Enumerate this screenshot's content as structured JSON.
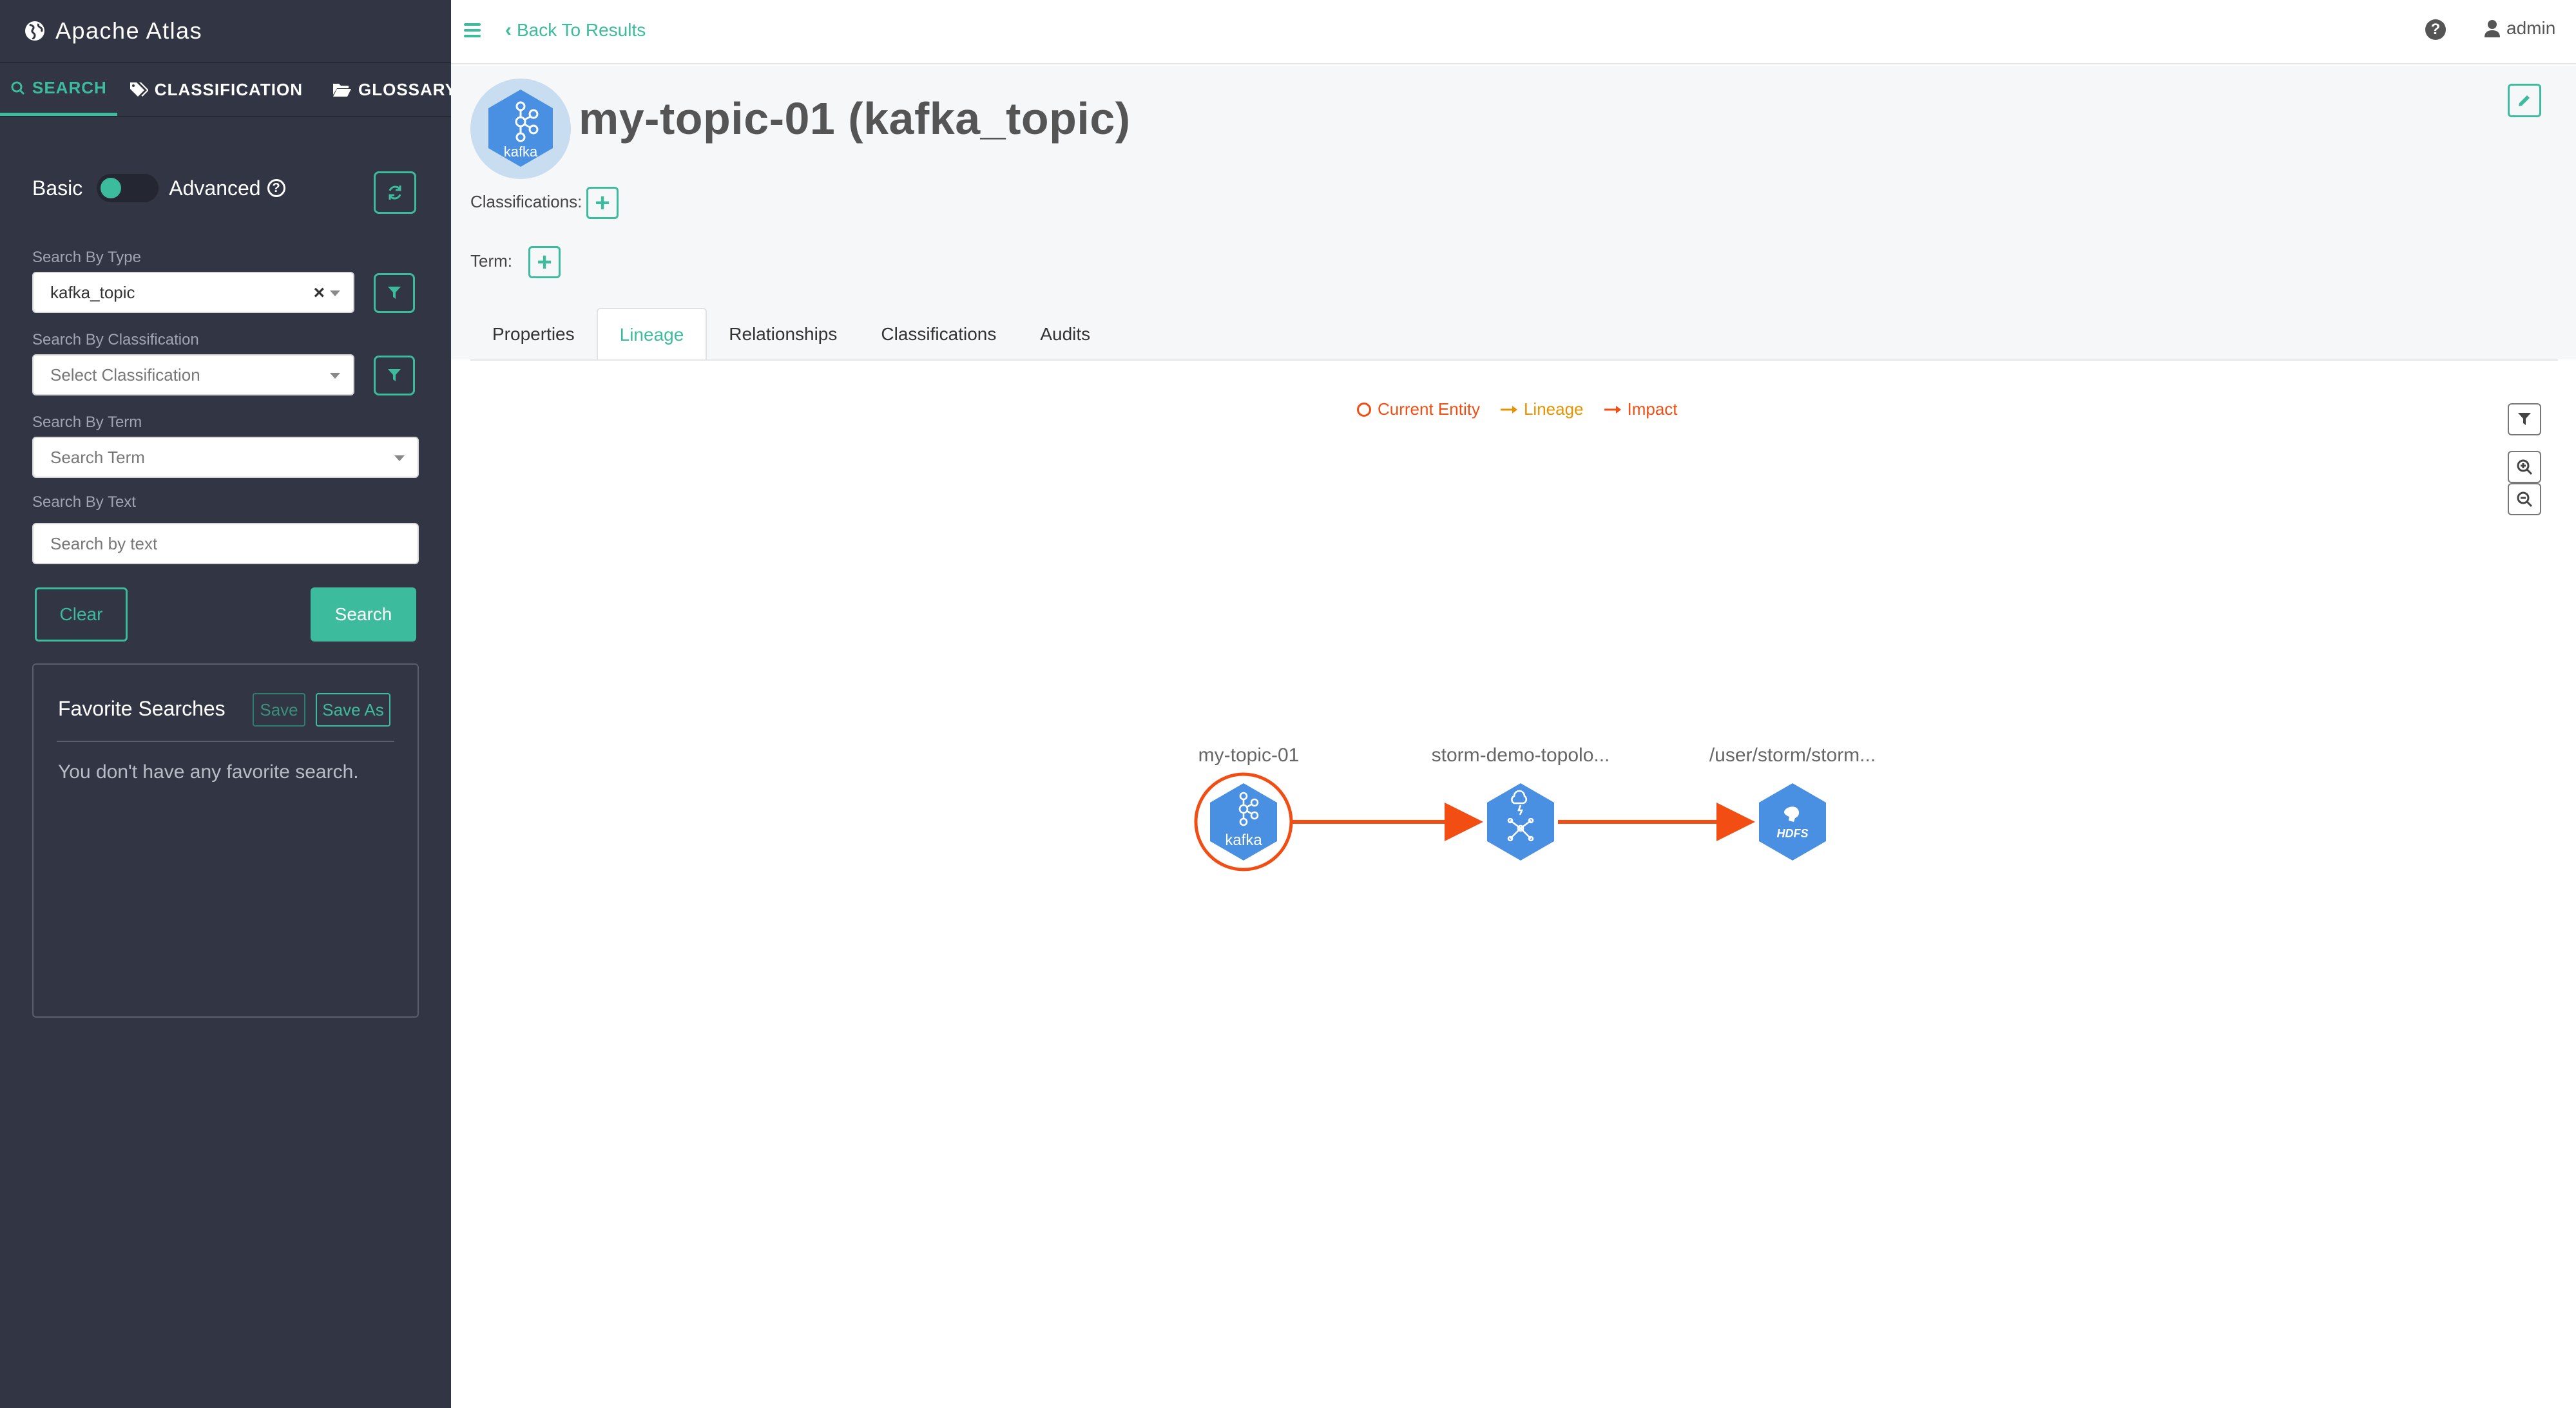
{
  "app": {
    "title": "Apache Atlas"
  },
  "sidebar": {
    "tabs": [
      {
        "label": "SEARCH",
        "icon": "search-icon",
        "active": true
      },
      {
        "label": "CLASSIFICATION",
        "icon": "tags-icon"
      },
      {
        "label": "GLOSSARY",
        "icon": "folder-open-icon"
      }
    ],
    "toggle": {
      "basic_label": "Basic",
      "advanced_label": "Advanced",
      "mode": "Basic"
    },
    "search_by_type": {
      "label": "Search By Type",
      "value": "kafka_topic"
    },
    "search_by_classification": {
      "label": "Search By Classification",
      "placeholder": "Select Classification"
    },
    "search_by_term": {
      "label": "Search By Term",
      "placeholder": "Search Term"
    },
    "search_by_text": {
      "label": "Search By Text",
      "placeholder": "Search by text"
    },
    "clear_label": "Clear",
    "search_label": "Search",
    "favorites": {
      "title": "Favorite Searches",
      "save_label": "Save",
      "save_as_label": "Save As",
      "empty_text": "You don't have any favorite search."
    }
  },
  "topbar": {
    "back_label": "Back To Results",
    "user": "admin"
  },
  "entity": {
    "title": "my-topic-01 (kafka_topic)",
    "icon_text": "kafka",
    "classifications_label": "Classifications:",
    "term_label": "Term:"
  },
  "tabs": [
    {
      "label": "Properties"
    },
    {
      "label": "Lineage",
      "active": true
    },
    {
      "label": "Relationships"
    },
    {
      "label": "Classifications"
    },
    {
      "label": "Audits"
    }
  ],
  "legend": {
    "current_entity": "Current Entity",
    "lineage": "Lineage",
    "impact": "Impact"
  },
  "lineage_graph": {
    "nodes": [
      {
        "label": "my-topic-01",
        "type": "kafka",
        "icon_text": "kafka",
        "current": true
      },
      {
        "label": "storm-demo-topolo...",
        "type": "storm"
      },
      {
        "label": "/user/storm/storm...",
        "type": "hdfs",
        "icon_text": "HDFS"
      }
    ]
  },
  "colors": {
    "accent": "#3dbb9d",
    "sidebar_bg": "#323544",
    "impact": "#f24e14",
    "lineage": "#e59400",
    "node_fill": "#4a90e2"
  }
}
